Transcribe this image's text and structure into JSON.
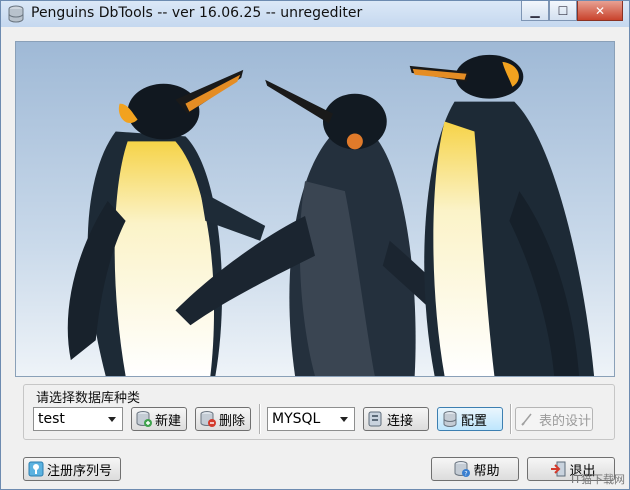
{
  "window": {
    "title": "Penguins DbTools -- ver 16.06.25 -- unregediter"
  },
  "db_group": {
    "label": "请选择数据库种类",
    "database_select": {
      "value": "test"
    },
    "new_button": "新建",
    "delete_button": "删除",
    "dbtype_select": {
      "value": "MYSQL"
    },
    "connect_button": "连接",
    "config_button": "配置",
    "table_design_button": "表的设计"
  },
  "footer": {
    "register_button": "注册序列号",
    "help_button": "帮助",
    "exit_button": "退出"
  },
  "watermark": "IT猫下载网"
}
